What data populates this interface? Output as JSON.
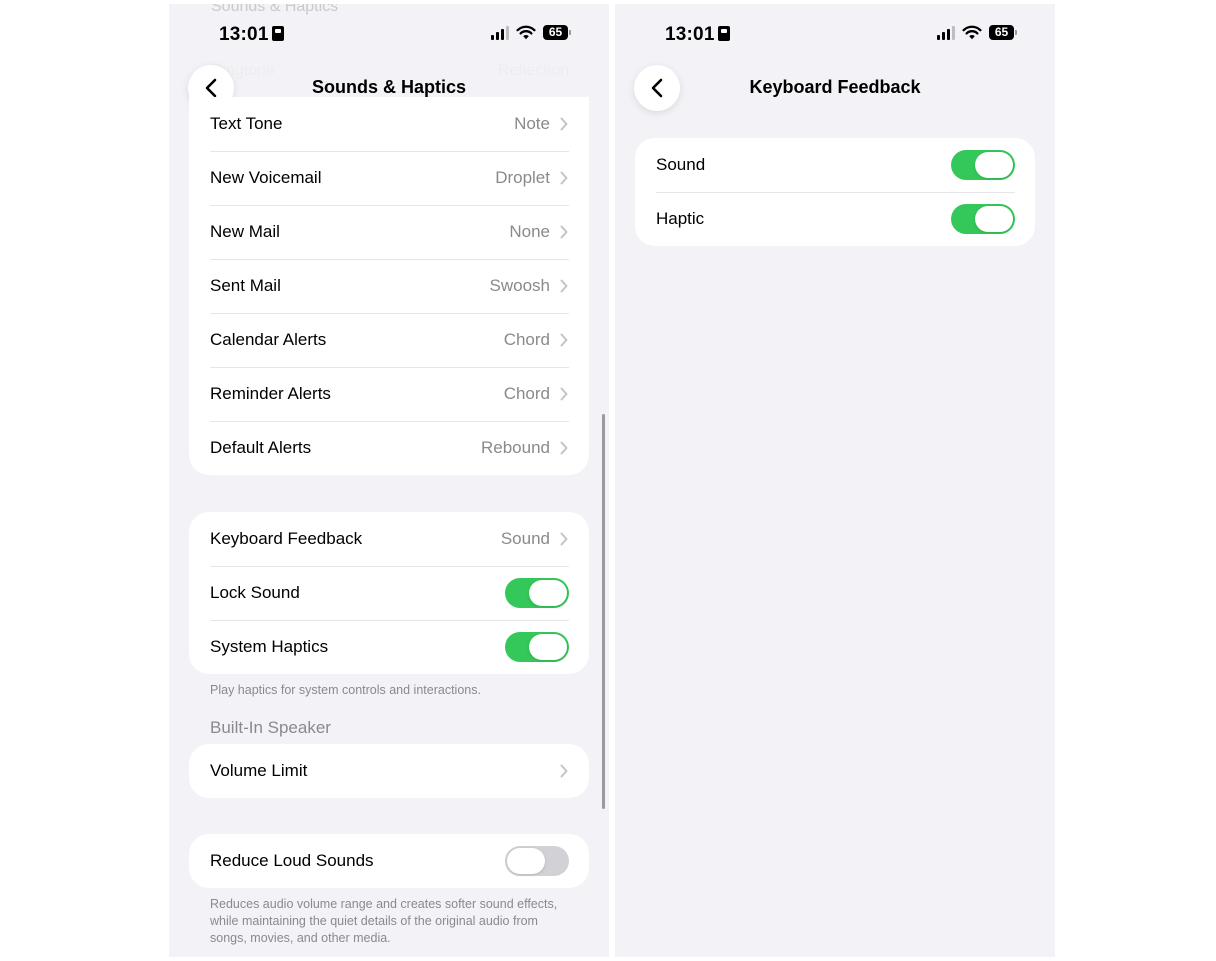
{
  "left_screen": {
    "status": {
      "time": "13:01",
      "battery": "65"
    },
    "faded_rows": {
      "top": "Sounds & Haptics",
      "ringtone_label": "Ringtone",
      "ringtone_value": "Reflection"
    },
    "nav": {
      "title": "Sounds & Haptics"
    },
    "tones": [
      {
        "label": "Text Tone",
        "value": "Note"
      },
      {
        "label": "New Voicemail",
        "value": "Droplet"
      },
      {
        "label": "New Mail",
        "value": "None"
      },
      {
        "label": "Sent Mail",
        "value": "Swoosh"
      },
      {
        "label": "Calendar Alerts",
        "value": "Chord"
      },
      {
        "label": "Reminder Alerts",
        "value": "Chord"
      },
      {
        "label": "Default Alerts",
        "value": "Rebound"
      }
    ],
    "feedback": {
      "keyboard_label": "Keyboard Feedback",
      "keyboard_value": "Sound",
      "lock_sound_label": "Lock Sound",
      "lock_sound_on": true,
      "system_haptics_label": "System Haptics",
      "system_haptics_on": true,
      "footer": "Play haptics for system controls and interactions."
    },
    "speaker": {
      "header": "Built-In Speaker",
      "volume_limit_label": "Volume Limit"
    },
    "loud": {
      "label": "Reduce Loud Sounds",
      "on": false,
      "footer": "Reduces audio volume range and creates softer sound effects, while maintaining the quiet details of the original audio from songs, movies, and other media."
    }
  },
  "right_screen": {
    "status": {
      "time": "13:01",
      "battery": "65"
    },
    "nav": {
      "title": "Keyboard Feedback"
    },
    "options": [
      {
        "label": "Sound",
        "on": true
      },
      {
        "label": "Haptic",
        "on": true
      }
    ]
  },
  "colors": {
    "background": "#f2f2f7",
    "card": "#ffffff",
    "toggle_on": "#34c759",
    "toggle_off": "#d1d1d6",
    "secondary_text": "#8a8a8e",
    "separator": "#e5e5ea"
  },
  "icons": {
    "back": "chevron-left-icon",
    "disclosure": "chevron-right-icon",
    "signal": "cellular-signal-icon",
    "wifi": "wifi-icon",
    "battery": "battery-icon",
    "focus": "person-focus-icon"
  }
}
